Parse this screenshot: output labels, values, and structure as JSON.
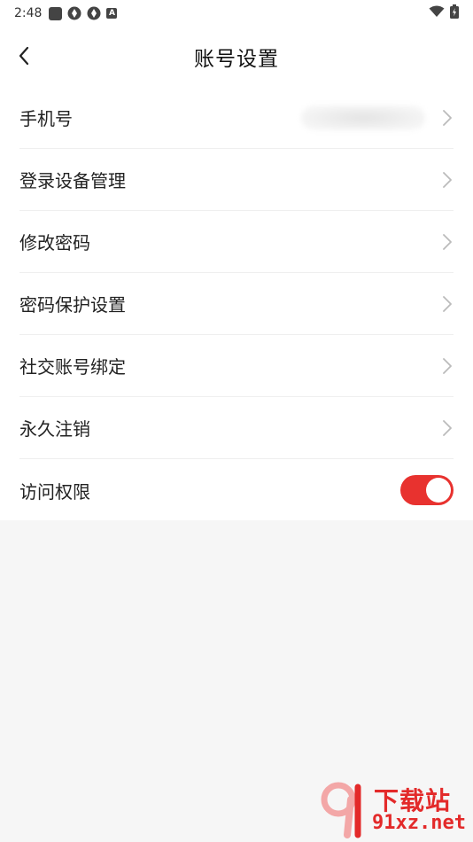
{
  "status_bar": {
    "time": "2:48"
  },
  "header": {
    "title": "账号设置"
  },
  "list": {
    "items": [
      {
        "label": "手机号",
        "type": "link"
      },
      {
        "label": "登录设备管理",
        "type": "link"
      },
      {
        "label": "修改密码",
        "type": "link"
      },
      {
        "label": "密码保护设置",
        "type": "link"
      },
      {
        "label": "社交账号绑定",
        "type": "link"
      },
      {
        "label": "永久注销",
        "type": "link"
      },
      {
        "label": "访问权限",
        "type": "toggle",
        "value": true
      }
    ]
  },
  "colors": {
    "accent": "#e8322f",
    "background": "#f6f6f6",
    "surface": "#ffffff"
  },
  "watermark": {
    "cn": "下载站",
    "en": "91xz.net"
  }
}
